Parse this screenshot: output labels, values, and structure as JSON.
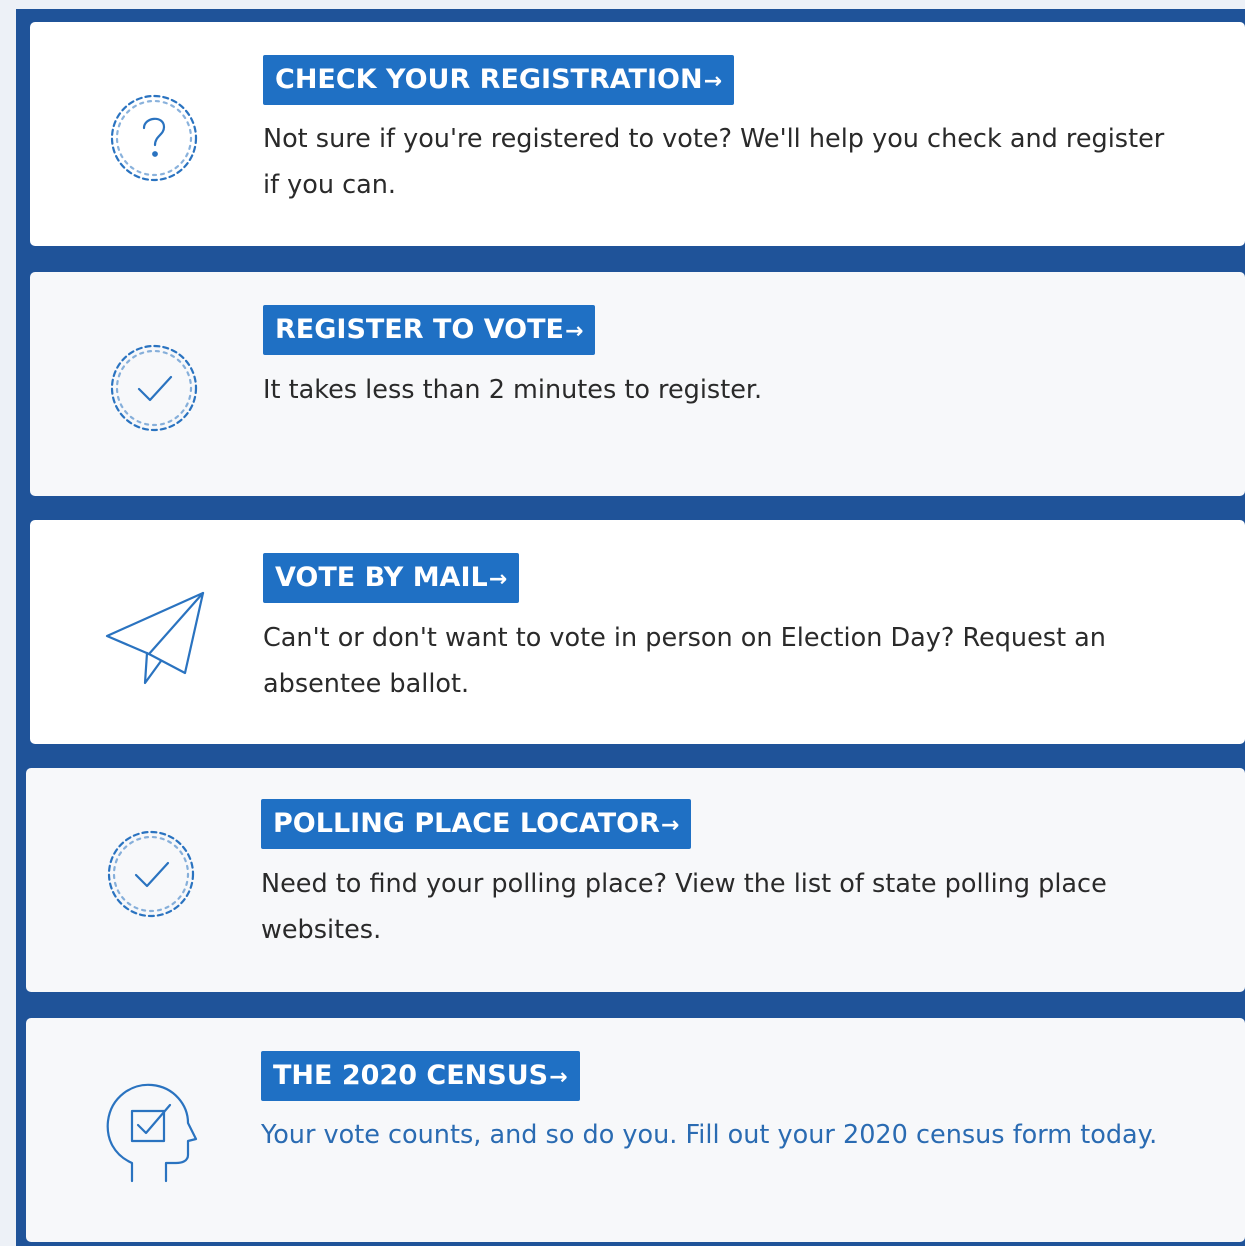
{
  "colors": {
    "frame": "#1f5399",
    "title_background": "#1f70c4",
    "title_text": "#ffffff",
    "body_text": "#2a2a2a",
    "census_text": "#2a6bb2",
    "icon_stroke": "#2a73c0"
  },
  "items": [
    {
      "icon": "question-badge-icon",
      "title": "CHECK YOUR REGISTRATION",
      "arrow": "→",
      "description": "Not sure if you're registered to vote? We'll help you check and register if you can."
    },
    {
      "icon": "check-badge-icon",
      "title": "REGISTER TO VOTE",
      "arrow": "→",
      "description": "It takes less than 2 minutes to register."
    },
    {
      "icon": "paper-plane-icon",
      "title": "VOTE BY MAIL",
      "arrow": "→",
      "description": "Can't or don't want to vote in person on Election Day? Request an absentee ballot."
    },
    {
      "icon": "check-badge-icon",
      "title": "POLLING PLACE LOCATOR",
      "arrow": "→",
      "description": "Need to find your polling place? View the list of state polling place websites."
    },
    {
      "icon": "head-checkbox-icon",
      "title": "THE 2020 CENSUS",
      "arrow": "→",
      "description": "Your vote counts, and so do you. Fill out your 2020 census form today."
    }
  ]
}
